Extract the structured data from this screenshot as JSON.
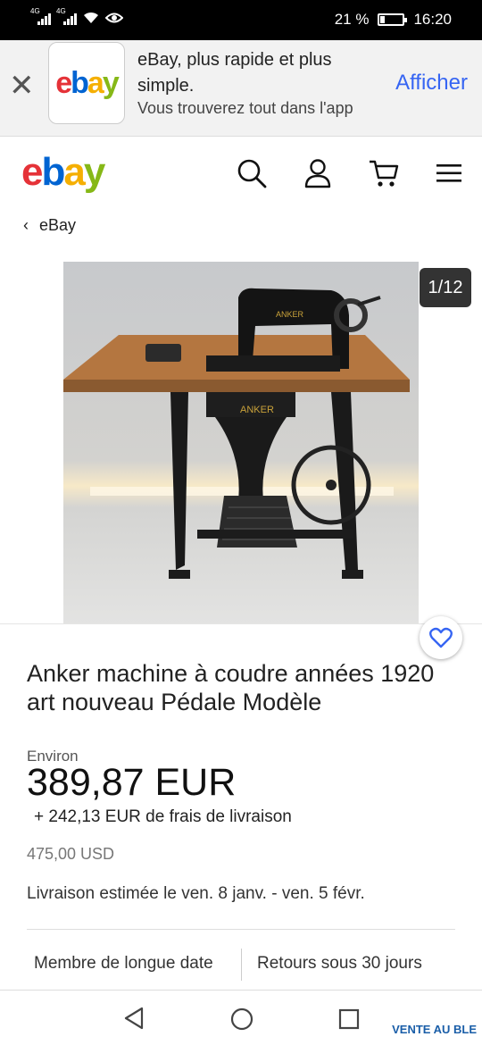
{
  "status_bar": {
    "net1": "4G",
    "net2": "4G",
    "battery": "21 %",
    "time": "16:20",
    "battery_level": 0.21
  },
  "app_banner": {
    "close_icon": "close-icon",
    "title": "eBay, plus rapide et plus simple.",
    "subtitle": "Vous trouverez tout dans l'app",
    "action": "Afficher",
    "logo": {
      "e": "e",
      "b": "b",
      "a": "a",
      "y": "y"
    }
  },
  "header": {
    "logo": {
      "e": "e",
      "b": "b",
      "a": "a",
      "y": "y"
    },
    "icons": [
      "search-icon",
      "user-icon",
      "cart-icon",
      "menu-icon"
    ]
  },
  "breadcrumb": {
    "label": "eBay"
  },
  "gallery": {
    "counter": "1/12",
    "machine_brand": "ANKER"
  },
  "listing": {
    "title": "Anker machine à coudre années 1920 art nouveau Pédale Modèle",
    "approx_label": "Environ",
    "price": "389,87 EUR",
    "shipping": "+ 242,13 EUR de frais de livraison",
    "original_price": "475,00 USD",
    "delivery": "Livraison estimée le ven. 8 janv. - ven. 5 févr.",
    "features": [
      "Membre de longue date",
      "Retours sous 30 jours"
    ]
  },
  "colors": {
    "accent": "#3665f3",
    "ebay_red": "#e53238",
    "ebay_blue": "#0064d2",
    "ebay_yellow": "#f5af02",
    "ebay_green": "#86b817"
  },
  "navbar": {
    "watermark": "VENTE AU BLE"
  }
}
